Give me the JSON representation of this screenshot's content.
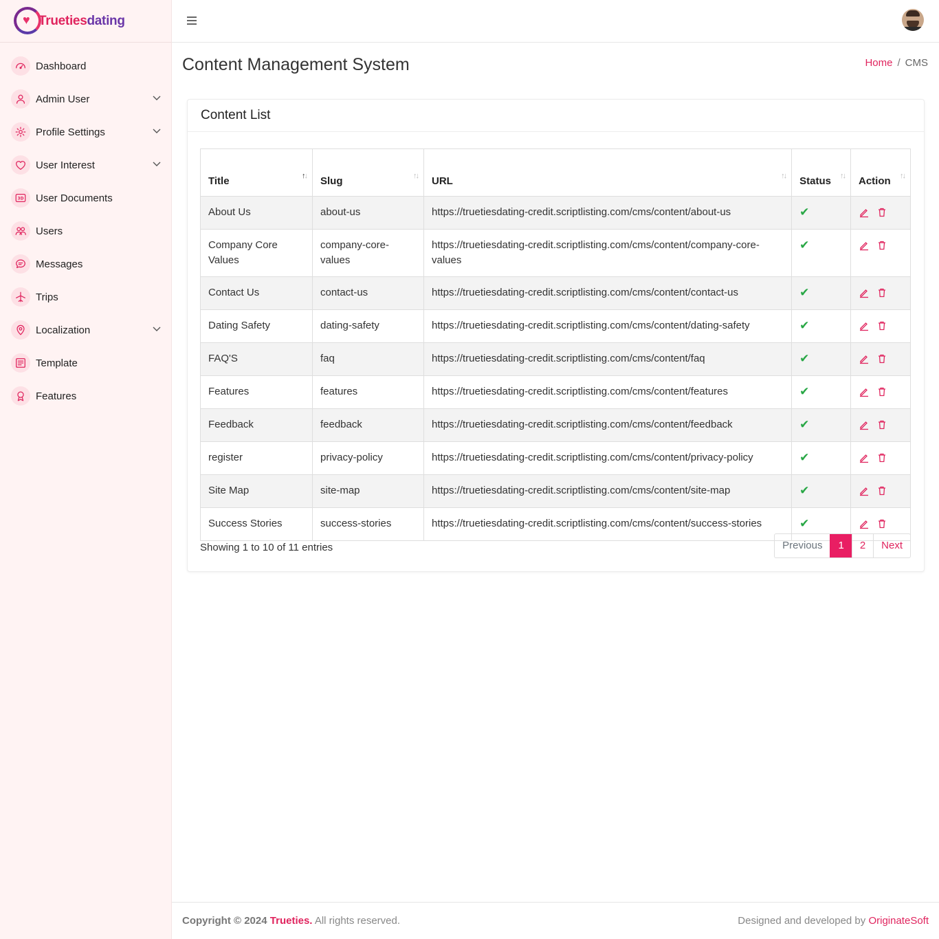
{
  "brand": {
    "name_part1": "Trueties",
    "name_part2": "dating"
  },
  "sidebar": {
    "items": [
      {
        "label": "Dashboard",
        "icon": "gauge-icon",
        "has_submenu": false
      },
      {
        "label": "Admin User",
        "icon": "user-icon",
        "has_submenu": true
      },
      {
        "label": "Profile Settings",
        "icon": "gear-icon",
        "has_submenu": true
      },
      {
        "label": "User Interest",
        "icon": "heart-icon",
        "has_submenu": true
      },
      {
        "label": "User Documents",
        "icon": "3d-icon",
        "has_submenu": false
      },
      {
        "label": "Users",
        "icon": "users-icon",
        "has_submenu": false
      },
      {
        "label": "Messages",
        "icon": "chat-icon",
        "has_submenu": false
      },
      {
        "label": "Trips",
        "icon": "plane-icon",
        "has_submenu": false
      },
      {
        "label": "Localization",
        "icon": "location-pin-icon",
        "has_submenu": true
      },
      {
        "label": "Template",
        "icon": "template-icon",
        "has_submenu": false
      },
      {
        "label": "Features",
        "icon": "award-icon",
        "has_submenu": false
      }
    ]
  },
  "header": {
    "page_title": "Content Management System",
    "breadcrumb": {
      "home": "Home",
      "separator": "/",
      "current": "CMS"
    }
  },
  "card": {
    "title": "Content List",
    "columns": {
      "title": "Title",
      "slug": "Slug",
      "url": "URL",
      "status": "Status",
      "action": "Action"
    },
    "rows": [
      {
        "title": "About Us",
        "slug": "about-us",
        "url": "https://truetiesdating-credit.scriptlisting.com/cms/content/about-us",
        "status": "active"
      },
      {
        "title": "Company Core Values",
        "slug": "company-core-values",
        "url": "https://truetiesdating-credit.scriptlisting.com/cms/content/company-core-values",
        "status": "active"
      },
      {
        "title": "Contact Us",
        "slug": "contact-us",
        "url": "https://truetiesdating-credit.scriptlisting.com/cms/content/contact-us",
        "status": "active"
      },
      {
        "title": "Dating Safety",
        "slug": "dating-safety",
        "url": "https://truetiesdating-credit.scriptlisting.com/cms/content/dating-safety",
        "status": "active"
      },
      {
        "title": "FAQ'S",
        "slug": "faq",
        "url": "https://truetiesdating-credit.scriptlisting.com/cms/content/faq",
        "status": "active"
      },
      {
        "title": "Features",
        "slug": "features",
        "url": "https://truetiesdating-credit.scriptlisting.com/cms/content/features",
        "status": "active"
      },
      {
        "title": "Feedback",
        "slug": "feedback",
        "url": "https://truetiesdating-credit.scriptlisting.com/cms/content/feedback",
        "status": "active"
      },
      {
        "title": "register",
        "slug": "privacy-policy",
        "url": "https://truetiesdating-credit.scriptlisting.com/cms/content/privacy-policy",
        "status": "active"
      },
      {
        "title": "Site Map",
        "slug": "site-map",
        "url": "https://truetiesdating-credit.scriptlisting.com/cms/content/site-map",
        "status": "active"
      },
      {
        "title": "Success Stories",
        "slug": "success-stories",
        "url": "https://truetiesdating-credit.scriptlisting.com/cms/content/success-stories",
        "status": "active"
      }
    ],
    "info": "Showing 1 to 10 of 11 entries",
    "pagination": {
      "previous": "Previous",
      "pages": [
        "1",
        "2"
      ],
      "current": "1",
      "next": "Next"
    }
  },
  "footer": {
    "copyright_prefix": "Copyright © 2024",
    "brand": "Trueties.",
    "rights": "All rights reserved.",
    "designed_by": "Designed and developed by",
    "developer": "OriginateSoft"
  },
  "colors": {
    "accent": "#e0245e",
    "sidebar_bg": "#fff3f3",
    "status_green": "#28a745",
    "pager_active": "#e91e63"
  }
}
